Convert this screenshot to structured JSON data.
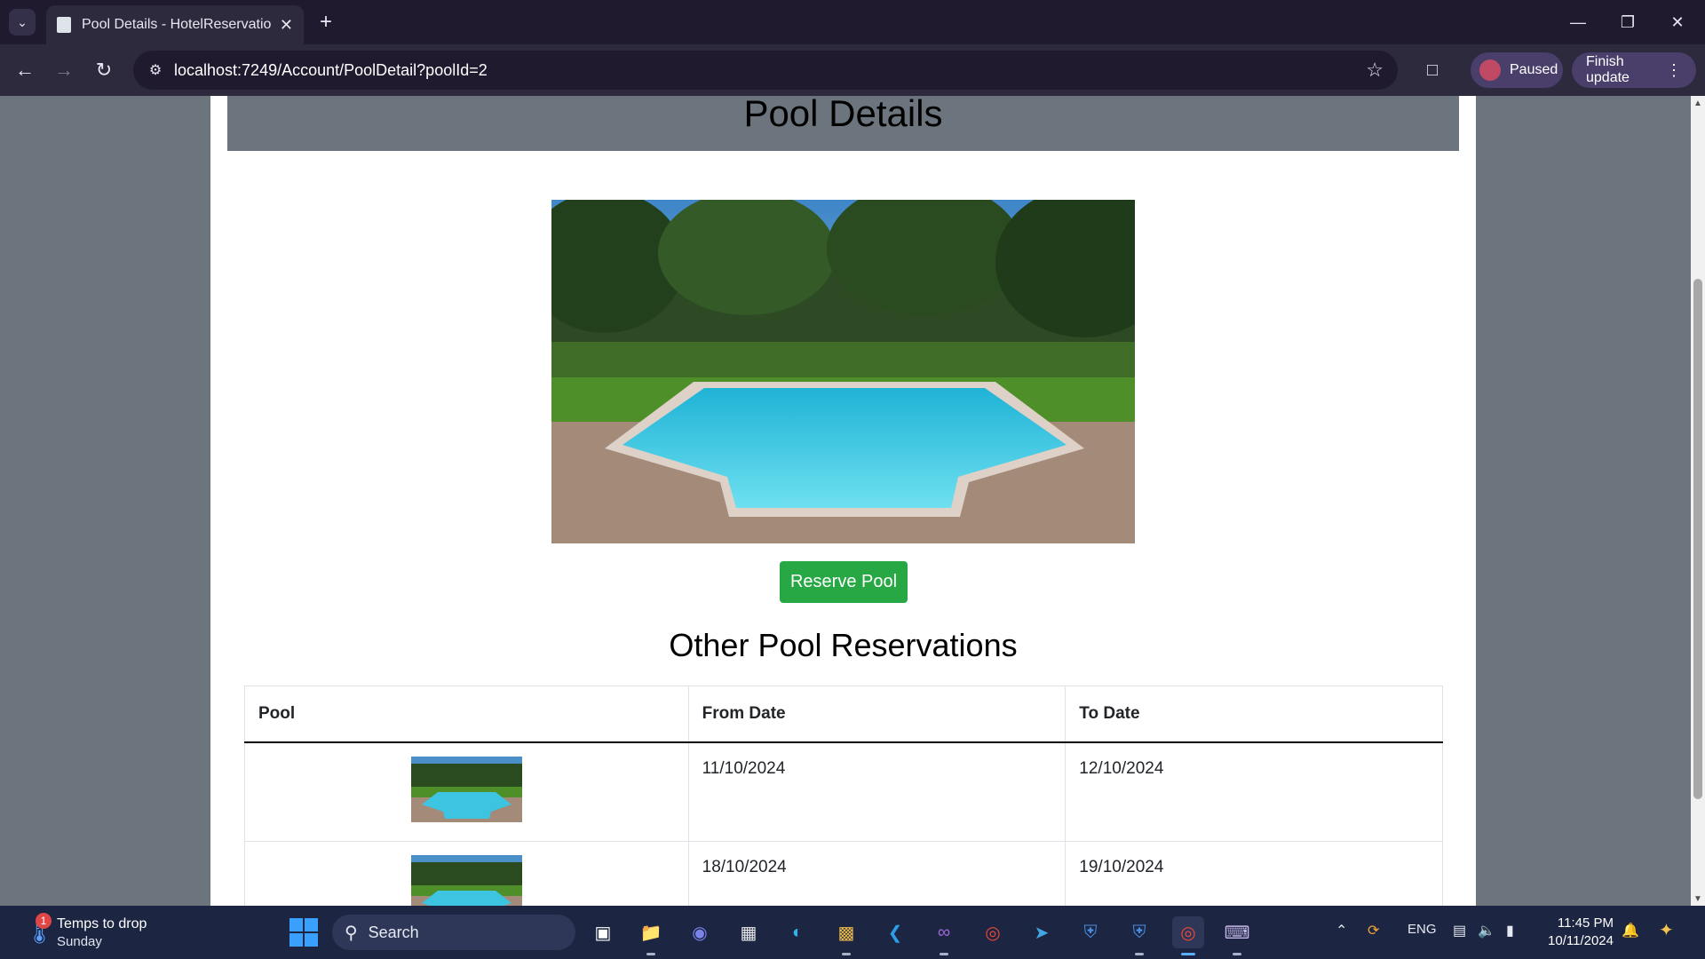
{
  "browser": {
    "tab_title": "Pool Details - HotelReservation",
    "tab_list_icon": "chevron-down-icon",
    "url": "localhost:7249/Account/PoolDetail?poolId=2",
    "profile_label": "Paused",
    "update_label": "Finish update"
  },
  "page": {
    "title": "Pool Details",
    "reserve_button": "Reserve Pool",
    "other_reservations_title": "Other Pool Reservations",
    "table": {
      "headers": [
        "Pool",
        "From Date",
        "To Date"
      ],
      "rows": [
        {
          "from": "11/10/2024",
          "to": "12/10/2024"
        },
        {
          "from": "18/10/2024",
          "to": "19/10/2024"
        }
      ]
    },
    "colors": {
      "header_band": "#6c757d",
      "reserve_button": "#28a745"
    }
  },
  "taskbar": {
    "weather_title": "Temps to drop",
    "weather_subtitle": "Sunday",
    "weather_badge": "1",
    "search_placeholder": "Search",
    "language": "ENG",
    "time": "11:45 PM",
    "date": "10/11/2024"
  }
}
